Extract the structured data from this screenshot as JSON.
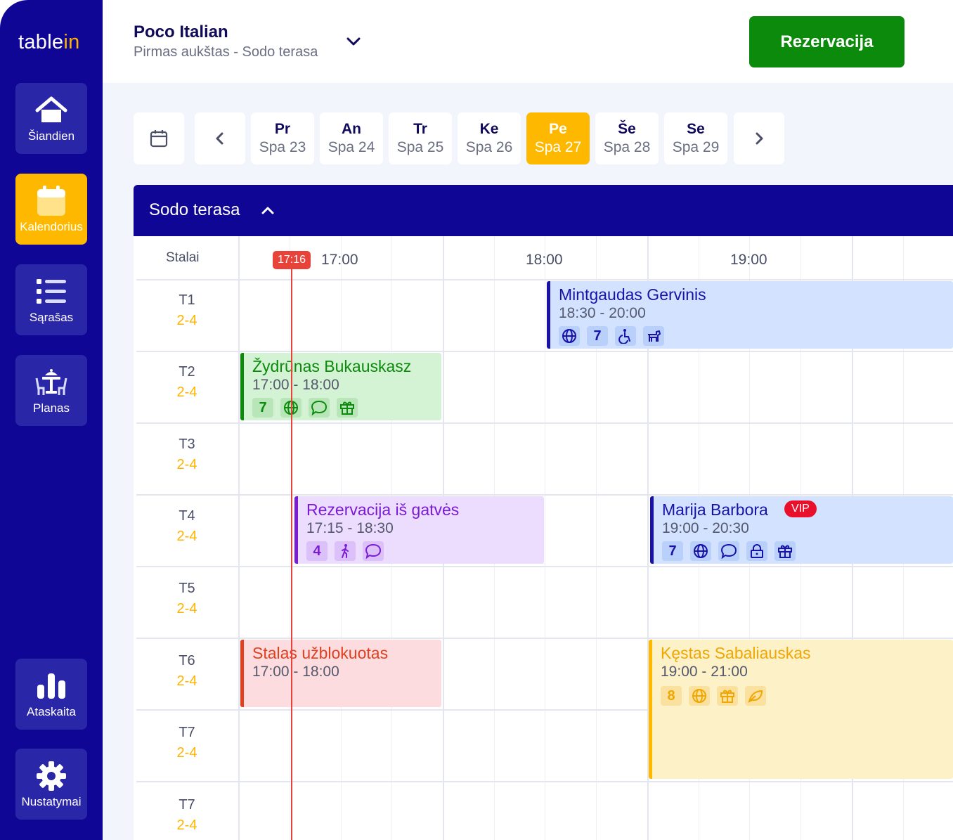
{
  "app": {
    "logo_main": "table",
    "logo_accent": "in"
  },
  "sidebar": {
    "items": [
      {
        "label": "Šiandien",
        "icon": "home-icon"
      },
      {
        "label": "Kalendorius",
        "icon": "calendar-icon",
        "active": true
      },
      {
        "label": "Sąrašas",
        "icon": "list-icon"
      },
      {
        "label": "Planas",
        "icon": "floor-plan-icon"
      },
      {
        "label": "Ataskaita",
        "icon": "bar-chart-icon"
      },
      {
        "label": "Nustatymai",
        "icon": "gear-icon"
      }
    ]
  },
  "header": {
    "venue_name": "Poco Italian",
    "venue_area": "Pirmas aukštas - Sodo terasa",
    "reserve_label": "Rezervacija"
  },
  "days": [
    {
      "name": "Pr",
      "date": "Spa 23"
    },
    {
      "name": "An",
      "date": "Spa 24"
    },
    {
      "name": "Tr",
      "date": "Spa 25"
    },
    {
      "name": "Ke",
      "date": "Spa 26"
    },
    {
      "name": "Pe",
      "date": "Spa 27",
      "active": true
    },
    {
      "name": "Še",
      "date": "Spa 28"
    },
    {
      "name": "Se",
      "date": "Spa 29"
    }
  ],
  "panel": {
    "title": "Sodo terasa",
    "tables_header": "Stalai",
    "hours": [
      "17:00",
      "18:00",
      "19:00"
    ],
    "now_time": "17:16"
  },
  "tables": [
    {
      "name": "T1",
      "capacity": "2-4"
    },
    {
      "name": "T2",
      "capacity": "2-4"
    },
    {
      "name": "T3",
      "capacity": "2-4"
    },
    {
      "name": "T4",
      "capacity": "2-4"
    },
    {
      "name": "T5",
      "capacity": "2-4"
    },
    {
      "name": "T6",
      "capacity": "2-4"
    },
    {
      "name": "T7",
      "capacity": "2-4"
    },
    {
      "name": "T7",
      "capacity": "2-4"
    }
  ],
  "reservations": [
    {
      "name": "Mintgaudas Gervinis",
      "time": "18:30 - 20:00",
      "guests": "7",
      "icons": [
        "globe-icon",
        "wheelchair-icon",
        "dog-icon"
      ]
    },
    {
      "name": "Žydrūnas Bukauskasz",
      "time": "17:00 - 18:00",
      "guests": "7",
      "icons": [
        "globe-icon",
        "comment-icon",
        "gift-icon"
      ]
    },
    {
      "name": "Rezervacija iš gatvės",
      "time": "17:15 - 18:30",
      "guests": "4",
      "icons": [
        "walk-in-icon",
        "comment-icon"
      ]
    },
    {
      "name": "Marija Barbora",
      "time": "19:00 - 20:30",
      "guests": "7",
      "vip": "VIP",
      "icons": [
        "globe-icon",
        "comment-icon",
        "lock-icon",
        "gift-icon"
      ]
    },
    {
      "name": "Stalas užblokuotas",
      "time": "17:00 - 18:00"
    },
    {
      "name": "Kęstas Sabaliauskas",
      "time": "19:00 - 21:00",
      "guests": "8",
      "icons": [
        "globe-icon",
        "gift-icon",
        "leaf-icon"
      ]
    }
  ],
  "colors": {
    "brand_navy": "#0f0696",
    "accent_yellow": "#ffb800",
    "green": "#0c8a0c",
    "now_red": "#e8433a"
  }
}
